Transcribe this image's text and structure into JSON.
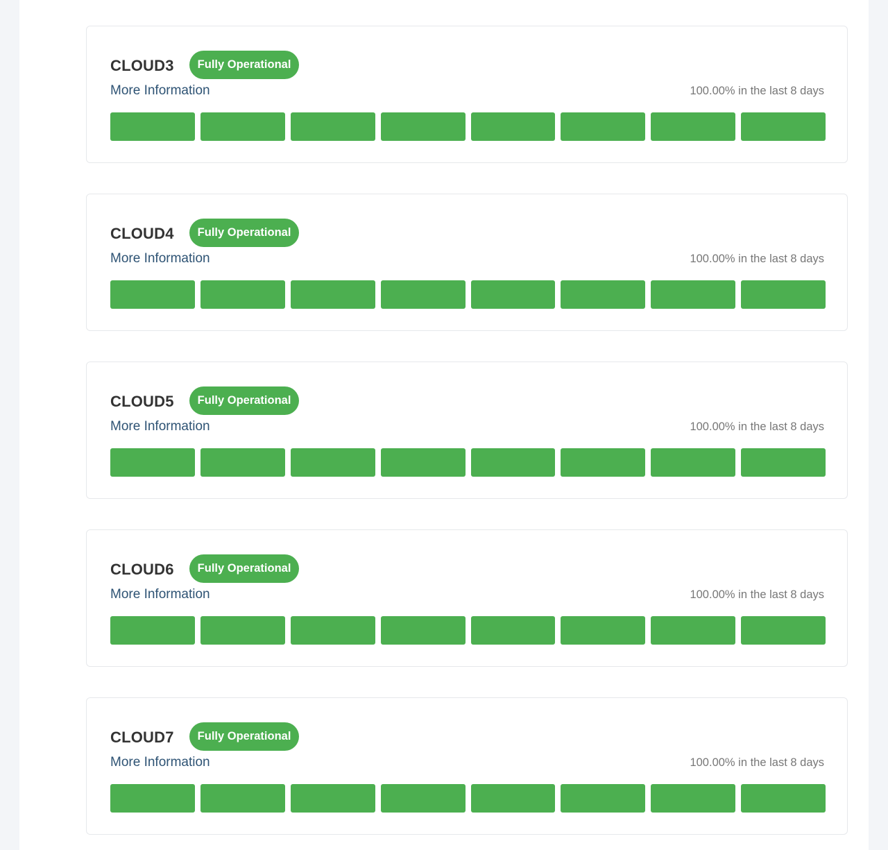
{
  "services": [
    {
      "name": "CLOUD3",
      "status_label": "Fully Operational",
      "more_info_label": "More Information",
      "uptime_text": "100.00% in the last 8 days",
      "days": [
        "operational",
        "operational",
        "operational",
        "operational",
        "operational",
        "operational",
        "operational",
        "operational"
      ]
    },
    {
      "name": "CLOUD4",
      "status_label": "Fully Operational",
      "more_info_label": "More Information",
      "uptime_text": "100.00% in the last 8 days",
      "days": [
        "operational",
        "operational",
        "operational",
        "operational",
        "operational",
        "operational",
        "operational",
        "operational"
      ]
    },
    {
      "name": "CLOUD5",
      "status_label": "Fully Operational",
      "more_info_label": "More Information",
      "uptime_text": "100.00% in the last 8 days",
      "days": [
        "operational",
        "operational",
        "operational",
        "operational",
        "operational",
        "operational",
        "operational",
        "operational"
      ]
    },
    {
      "name": "CLOUD6",
      "status_label": "Fully Operational",
      "more_info_label": "More Information",
      "uptime_text": "100.00% in the last 8 days",
      "days": [
        "operational",
        "operational",
        "operational",
        "operational",
        "operational",
        "operational",
        "operational",
        "operational"
      ]
    },
    {
      "name": "CLOUD7",
      "status_label": "Fully Operational",
      "more_info_label": "More Information",
      "uptime_text": "100.00% in the last 8 days",
      "days": [
        "operational",
        "operational",
        "operational",
        "operational",
        "operational",
        "operational",
        "operational",
        "operational"
      ]
    }
  ],
  "colors": {
    "operational": "#4caf50",
    "badge_bg": "#4caf50",
    "link": "#2e5374"
  }
}
